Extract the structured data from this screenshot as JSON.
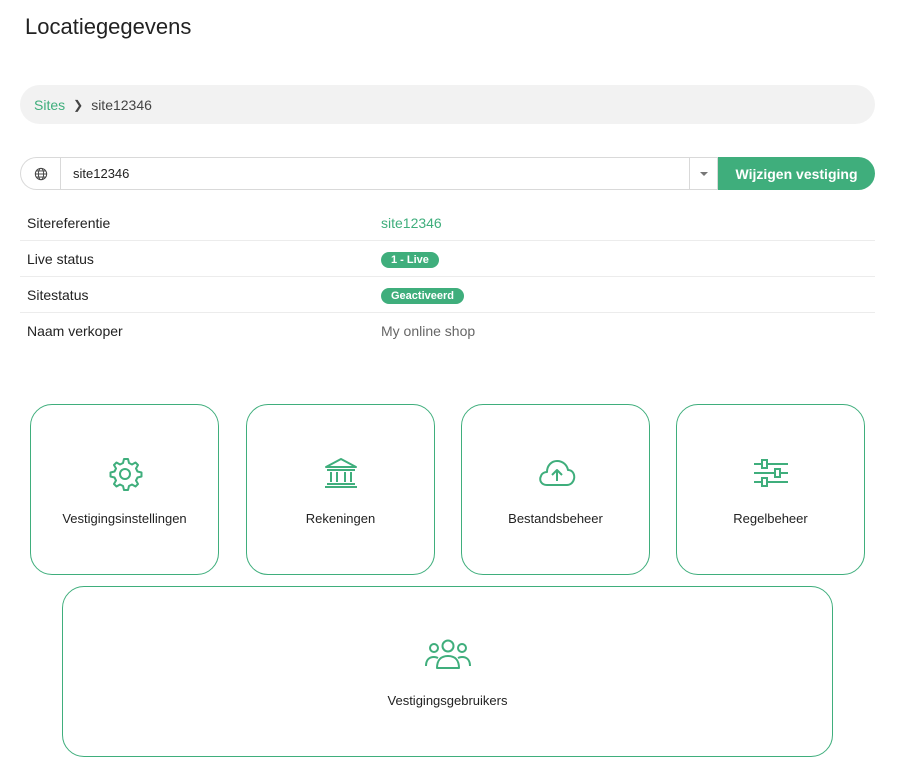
{
  "page": {
    "title": "Locatiegegevens"
  },
  "breadcrumb": {
    "items": [
      "Sites",
      "site12346"
    ]
  },
  "site_selector": {
    "value": "site12346",
    "button_label": "Wijzigen vestiging"
  },
  "info": {
    "rows": [
      {
        "label": "Sitereferentie",
        "value": "site12346"
      },
      {
        "label": "Live status",
        "value": "1 - Live"
      },
      {
        "label": "Sitestatus",
        "value": "Geactiveerd"
      },
      {
        "label": "Naam verkoper",
        "value": "My online shop"
      }
    ]
  },
  "tiles": [
    {
      "label": "Vestigingsinstellingen",
      "icon": "gear-icon"
    },
    {
      "label": "Rekeningen",
      "icon": "bank-icon"
    },
    {
      "label": "Bestandsbeheer",
      "icon": "cloud-upload-icon"
    },
    {
      "label": "Regelbeheer",
      "icon": "sliders-icon"
    },
    {
      "label": "Vestigingsgebruikers",
      "icon": "users-icon"
    }
  ],
  "colors": {
    "accent": "#3fae7c",
    "breadcrumb_bg": "#f2f2f2",
    "border": "#d9d9d9"
  }
}
